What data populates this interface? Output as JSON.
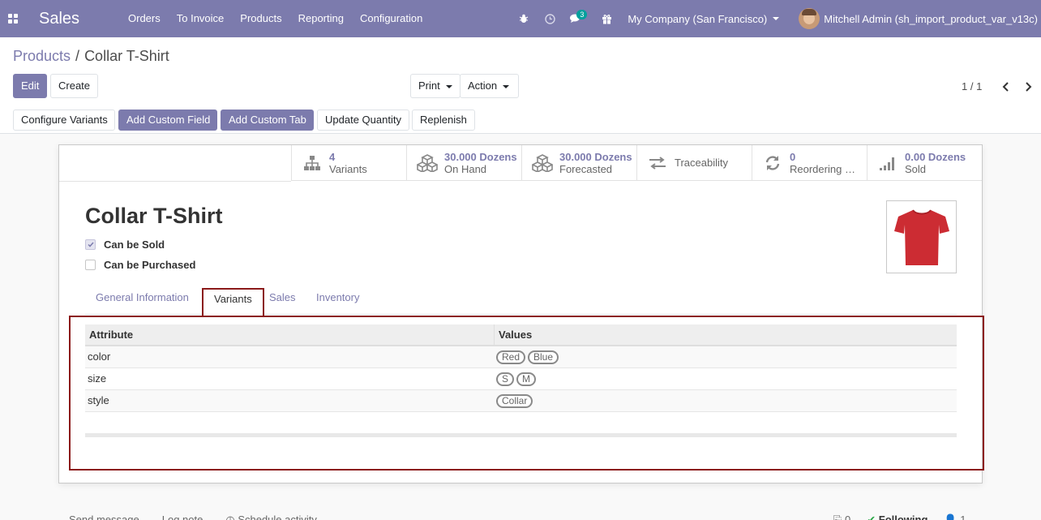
{
  "navbar": {
    "app_name": "Sales",
    "menu": [
      "Orders",
      "To Invoice",
      "Products",
      "Reporting",
      "Configuration"
    ],
    "messages_badge": "3",
    "company": "My Company (San Francisco)",
    "user": "Mitchell Admin (sh_import_product_var_v13c)"
  },
  "breadcrumb": {
    "parent": "Products",
    "separator": "/",
    "current": "Collar T-Shirt"
  },
  "buttons": {
    "edit": "Edit",
    "create": "Create",
    "print": "Print",
    "action": "Action"
  },
  "pager": "1 / 1",
  "statusbar": [
    "Configure Variants",
    "Add Custom Field",
    "Add Custom Tab",
    "Update Quantity",
    "Replenish"
  ],
  "smart_buttons": {
    "variants": {
      "value": "4",
      "label": "Variants"
    },
    "on_hand": {
      "value": "30.000 Dozens",
      "label": "On Hand"
    },
    "forecasted": {
      "value": "30.000 Dozens",
      "label": "Forecasted"
    },
    "traceability": {
      "label": "Traceability"
    },
    "reordering": {
      "value": "0",
      "label": "Reordering Rules"
    },
    "sold": {
      "value": "0.00 Dozens",
      "label": "Sold"
    }
  },
  "product": {
    "name": "Collar T-Shirt",
    "can_be_sold": "Can be Sold",
    "can_be_purchased": "Can be Purchased"
  },
  "tabs": [
    "General Information",
    "Variants",
    "Sales",
    "Inventory"
  ],
  "active_tab": "Variants",
  "variants_table": {
    "headers": [
      "Attribute",
      "Values"
    ],
    "rows": [
      {
        "attribute": "color",
        "values": [
          "Red",
          "Blue"
        ]
      },
      {
        "attribute": "size",
        "values": [
          "S",
          "M"
        ]
      },
      {
        "attribute": "style",
        "values": [
          "Collar"
        ]
      }
    ]
  },
  "chatter": {
    "send_message": "Send message",
    "log_note": "Log note",
    "schedule_activity": "Schedule activity",
    "attachments": "0",
    "following": "Following",
    "followers": "1"
  },
  "colors": {
    "brand": "#7c7bad",
    "highlight": "#8b1a1a"
  }
}
